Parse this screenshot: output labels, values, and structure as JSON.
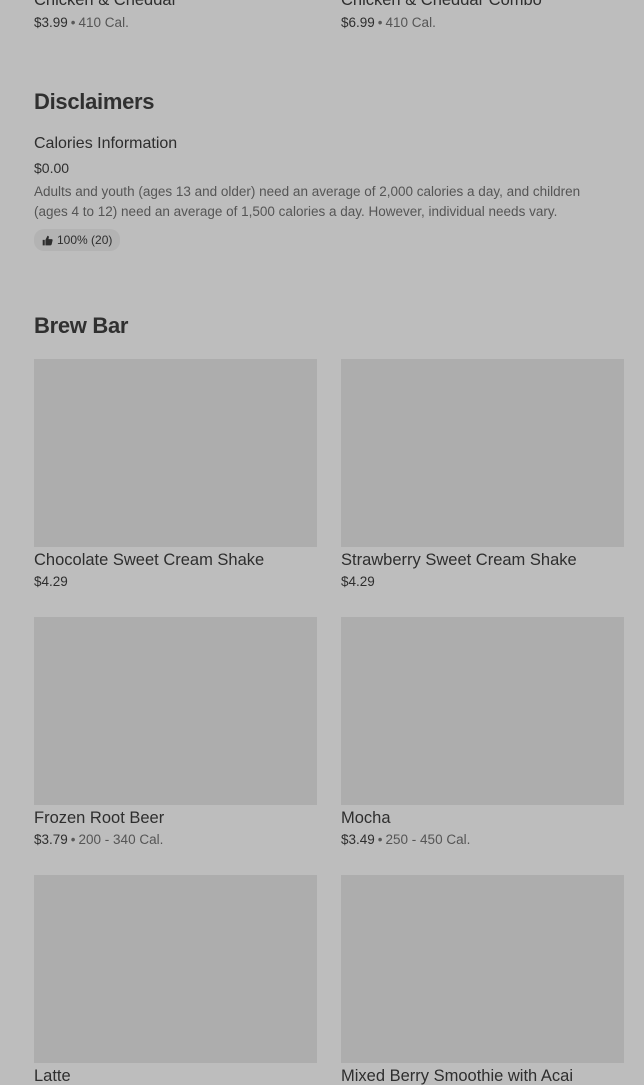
{
  "top_items": [
    {
      "name": "Chicken & Cheddar",
      "price": "$3.99",
      "calories": "410 Cal."
    },
    {
      "name": "Chicken & Cheddar Combo",
      "price": "$6.99",
      "calories": "410 Cal."
    }
  ],
  "disclaimers": {
    "title": "Disclaimers",
    "item": {
      "name": "Calories Information",
      "price": "$0.00",
      "description": "Adults and youth (ages 13 and older) need an average of 2,000 calories a day, and children (ages 4 to 12) need an average of 1,500 calories a day. However, individual needs vary.",
      "rating": "100% (20)"
    }
  },
  "brew_bar": {
    "title": "Brew Bar",
    "items": [
      {
        "name": "Chocolate Sweet Cream Shake",
        "price": "$4.29",
        "calories": ""
      },
      {
        "name": "Strawberry Sweet Cream Shake",
        "price": "$4.29",
        "calories": ""
      },
      {
        "name": "Frozen Root Beer",
        "price": "$3.79",
        "calories": "200 - 340 Cal."
      },
      {
        "name": "Mocha",
        "price": "$3.49",
        "calories": "250 - 450 Cal."
      },
      {
        "name": "Latte",
        "price": "",
        "calories": ""
      },
      {
        "name": "Mixed Berry Smoothie with Acai",
        "price": "",
        "calories": ""
      }
    ]
  },
  "separator": "•",
  "icons": {
    "rating": "thumbs-up-icon"
  }
}
